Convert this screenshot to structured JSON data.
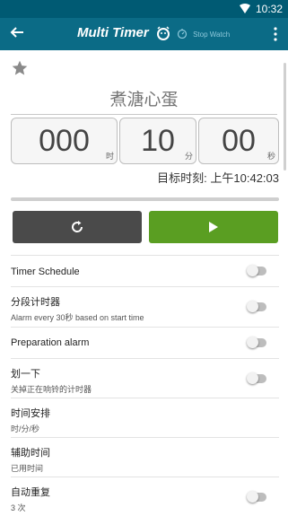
{
  "status_bar": {
    "time": "10:32"
  },
  "app_bar": {
    "title": "Multi Timer",
    "subtitle": "Stop Watch"
  },
  "timer": {
    "name": "煮溏心蛋",
    "hours": "000",
    "hours_unit": "时",
    "minutes": "10",
    "minutes_unit": "分",
    "seconds": "00",
    "seconds_unit": "秒",
    "target_time": "目标时刻: 上午10:42:03",
    "progress_fraction": 0.0
  },
  "settings": [
    {
      "label": "Timer Schedule",
      "sub": "",
      "toggle": false
    },
    {
      "label": "分段计时器",
      "sub": "Alarm every 30秒 based on start time",
      "toggle": false
    },
    {
      "label": "Preparation alarm",
      "sub": "",
      "toggle": false
    },
    {
      "label": "划一下",
      "sub": "关掉正在响铃的计时器",
      "toggle": false
    },
    {
      "label": "时间安排",
      "sub": "时/分/秒",
      "toggle": null
    },
    {
      "label": "辅助时间",
      "sub": "已用时间",
      "toggle": null
    },
    {
      "label": "自动重复",
      "sub": "3 次",
      "toggle": false
    }
  ],
  "colors": {
    "app_bar": "#0b6b86",
    "status_bar": "#005a73",
    "play_button": "#5a9e22",
    "reset_button": "#4a4a4a"
  }
}
